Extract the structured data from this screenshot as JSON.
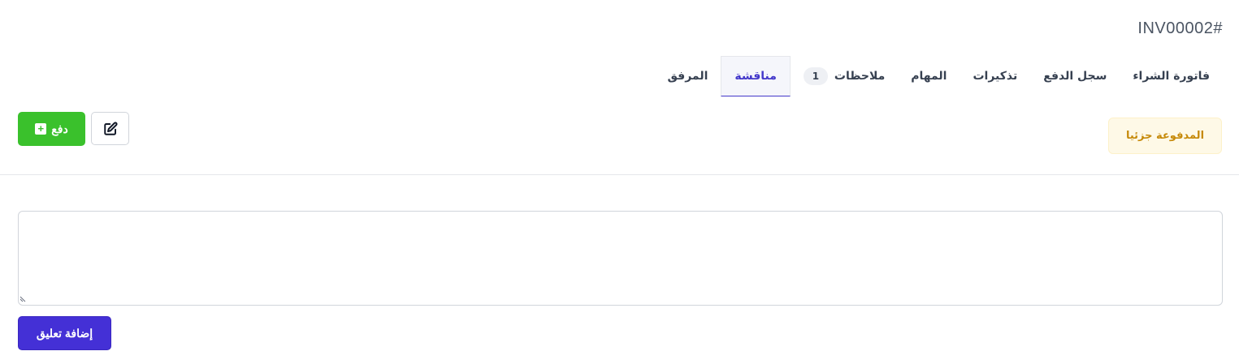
{
  "invoice": {
    "number": "INV00002#"
  },
  "tabs": [
    {
      "label": "فاتورة الشراء"
    },
    {
      "label": "سجل الدفع"
    },
    {
      "label": "تذكيرات"
    },
    {
      "label": "المهام"
    },
    {
      "label": "ملاحظات",
      "badge": "1"
    },
    {
      "label": "مناقشة",
      "active": true
    },
    {
      "label": "المرفق"
    }
  ],
  "status": {
    "label": "المدفوعة جزئيا",
    "color": "#c68a0a"
  },
  "actions": {
    "pay_label": "دفع",
    "pay_color": "#3ac12c"
  },
  "comment": {
    "value": "",
    "submit_label": "إضافة تعليق",
    "submit_color": "#4430d6"
  },
  "icons": {
    "edit": "edit-icon",
    "plus": "plus-icon",
    "resize": "resize-handle-icon"
  }
}
